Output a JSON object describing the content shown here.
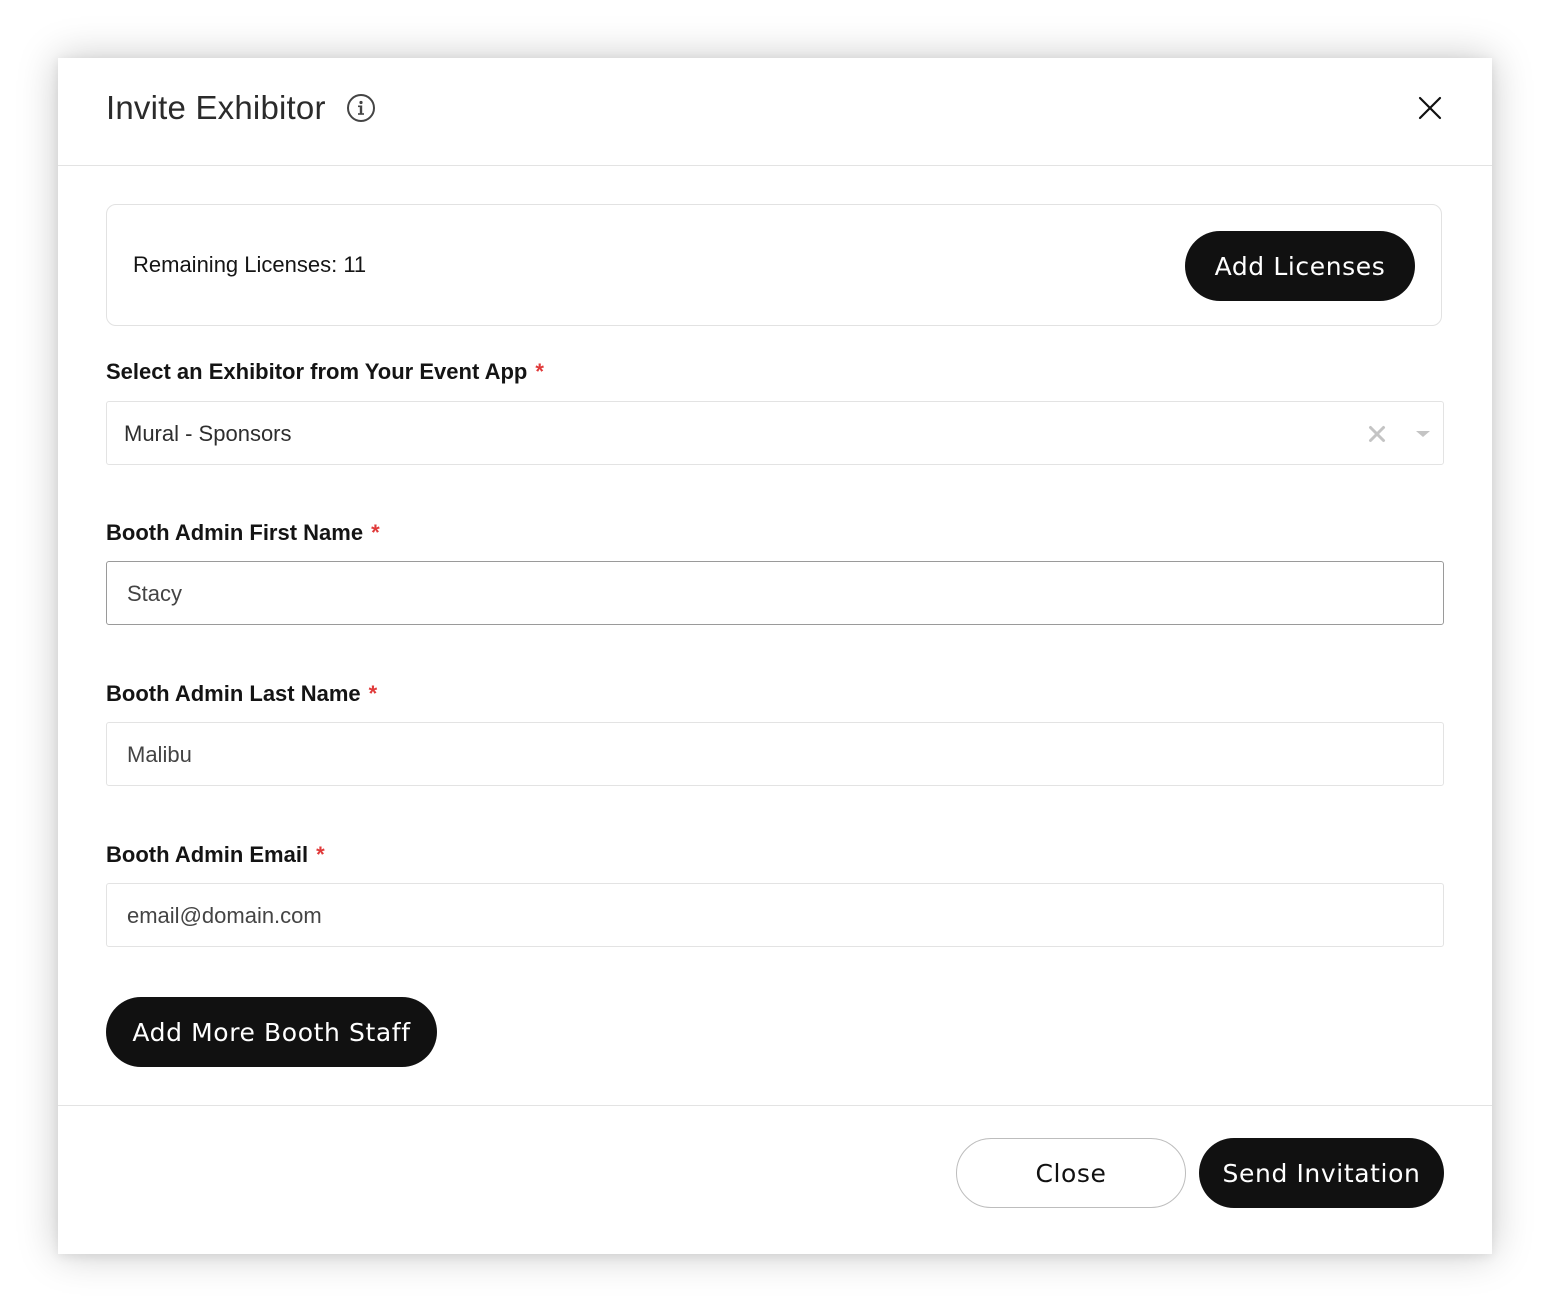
{
  "modal": {
    "title": "Invite Exhibitor",
    "info_icon": "info-circle-icon",
    "close_icon": "close-icon"
  },
  "licenses": {
    "remaining_text": "Remaining Licenses: 11",
    "add_button_label": "Add Licenses"
  },
  "form": {
    "exhibitor_select": {
      "label": "Select an Exhibitor from Your Event App",
      "required_marker": "*",
      "value": "Mural - Sponsors",
      "clear_icon": "clear-x-icon",
      "arrow_icon": "chevron-down-icon"
    },
    "first_name": {
      "label": "Booth Admin First Name",
      "required_marker": "*",
      "value": "Stacy"
    },
    "last_name": {
      "label": "Booth Admin Last Name",
      "required_marker": "*",
      "value": "Malibu"
    },
    "email": {
      "label": "Booth Admin Email",
      "required_marker": "*",
      "value": "email@domain.com"
    },
    "add_staff_label": "Add More Booth Staff"
  },
  "footer": {
    "close_label": "Close",
    "send_label": "Send Invitation"
  },
  "colors": {
    "primary_button": "#111111",
    "required": "#e03a3a",
    "border": "#e3e3e3"
  }
}
